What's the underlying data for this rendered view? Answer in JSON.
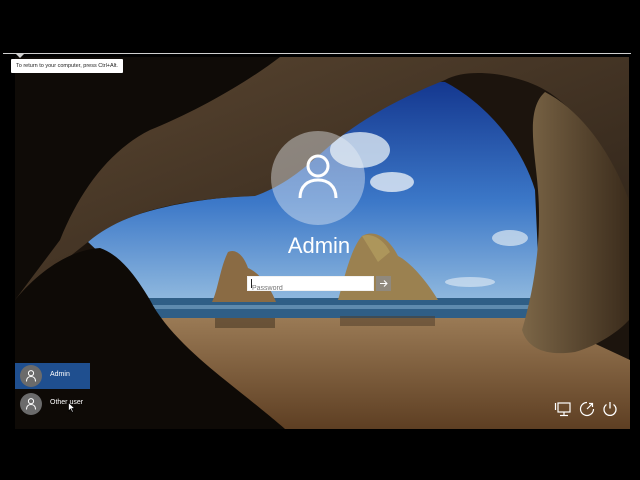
{
  "vm": {
    "tooltip": "To return to your computer, press Ctrl+Alt."
  },
  "login": {
    "username": "Admin",
    "password_placeholder": "Password"
  },
  "users": [
    {
      "name": "Admin",
      "selected": true
    },
    {
      "name": "Other user",
      "selected": false
    }
  ],
  "icons": {
    "user_picture": "user-silhouette-icon",
    "submit": "arrow-right-icon",
    "network": "network-icon",
    "ease_of_access": "ease-of-access-icon",
    "power": "power-icon"
  },
  "colors": {
    "selected_user_bg": "#1f4f8f",
    "text": "#ffffff"
  }
}
